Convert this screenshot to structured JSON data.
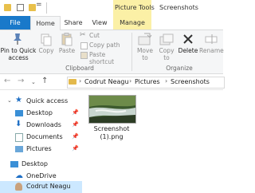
{
  "quick_access": {
    "undo_glyph": "="
  },
  "title": {
    "context_tab": "Picture Tools",
    "window_title": "Screenshots"
  },
  "tabs": {
    "file": "File",
    "home": "Home",
    "share": "Share",
    "view": "View",
    "manage": "Manage"
  },
  "ribbon": {
    "pin_label_1": "Pin to Quick",
    "pin_label_2": "access",
    "copy": "Copy",
    "paste": "Paste",
    "cut": "Cut",
    "copy_path": "Copy path",
    "paste_shortcut": "Paste shortcut",
    "clipboard_group": "Clipboard",
    "move_to_1": "Move",
    "move_to_2": "to",
    "copy_to_1": "Copy",
    "copy_to_2": "to",
    "delete": "Delete",
    "rename": "Rename",
    "organize_group": "Organize"
  },
  "address": {
    "crumbs": [
      "Codrut Neagu",
      "Pictures",
      "Screenshots"
    ]
  },
  "nav": {
    "items": [
      {
        "label": "Quick access"
      },
      {
        "label": "Desktop"
      },
      {
        "label": "Downloads"
      },
      {
        "label": "Documents"
      },
      {
        "label": "Pictures"
      },
      {
        "label": "Desktop"
      },
      {
        "label": "OneDrive"
      },
      {
        "label": "Codrut Neagu"
      }
    ]
  },
  "files": [
    {
      "name_line1": "Screenshot",
      "name_line2": "(1).png"
    }
  ],
  "colors": {
    "file_tab": "#1979ca",
    "context_tab": "#fbf0a6",
    "selected": "#cce8ff"
  }
}
